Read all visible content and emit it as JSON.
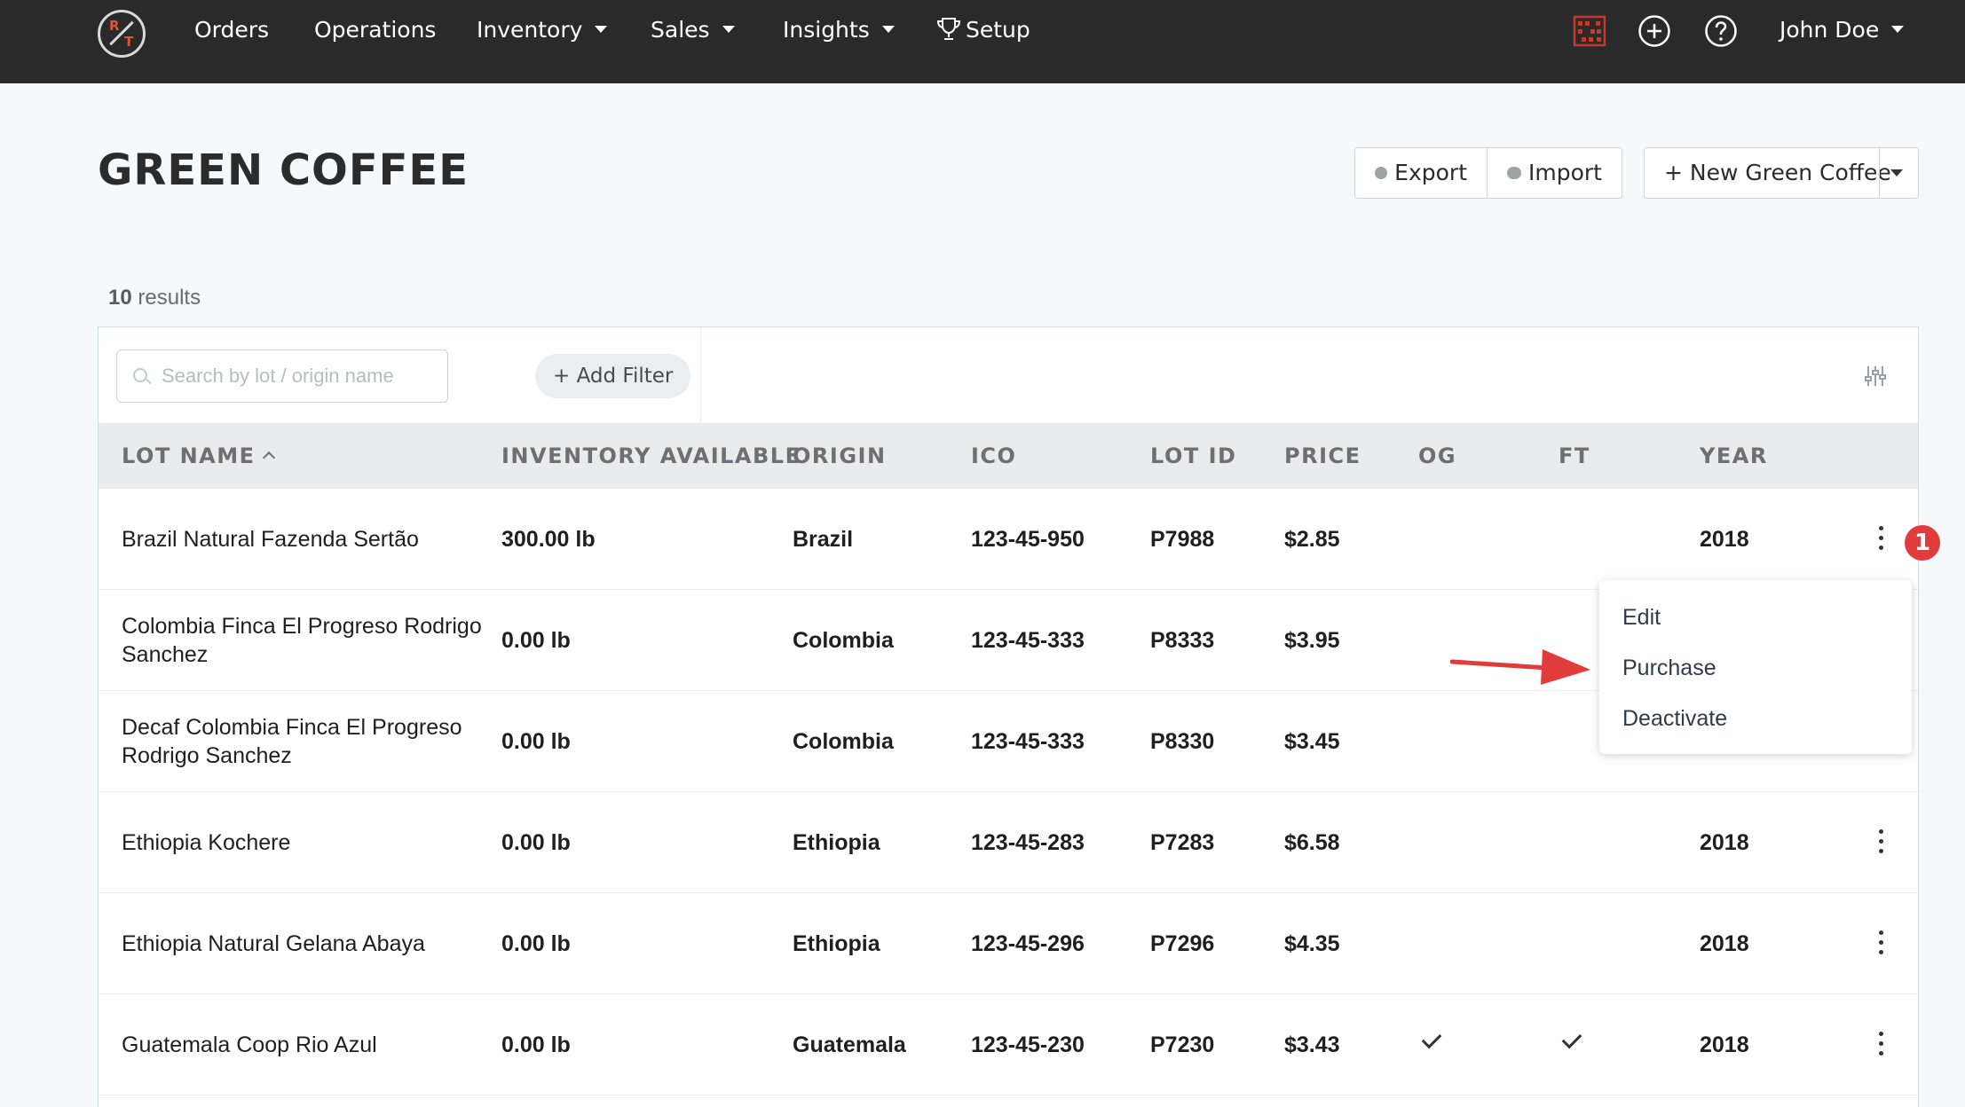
{
  "nav": {
    "logo_letters": [
      "R",
      "T"
    ],
    "items": [
      {
        "label": "Orders"
      },
      {
        "label": "Operations"
      },
      {
        "label": "Inventory"
      },
      {
        "label": "Sales"
      },
      {
        "label": "Insights"
      },
      {
        "label": "Setup"
      }
    ],
    "user": "John Doe",
    "icons": [
      "abacus-icon",
      "plus-circle-icon",
      "help-circle-icon",
      "trophy-icon"
    ]
  },
  "page": {
    "title": "GREEN COFFEE",
    "export_label": "Export",
    "import_label": "Import",
    "new_label": "+ New Green Coffee",
    "results_count": "10",
    "results_label": "results"
  },
  "toolbar": {
    "search_placeholder": "Search by lot / origin name",
    "add_filter_label": "+ Add Filter"
  },
  "table": {
    "columns": [
      "LOT NAME",
      "INVENTORY AVAILABLE",
      "ORIGIN",
      "ICO",
      "LOT ID",
      "PRICE",
      "OG",
      "FT",
      "YEAR"
    ],
    "rows": [
      {
        "name": "Brazil Natural Fazenda Sertão",
        "inventory": "300.00 lb",
        "origin": "Brazil",
        "ico": "123-45-950",
        "lot_id": "P7988",
        "price": "$2.85",
        "og": false,
        "ft": false,
        "year": "2018"
      },
      {
        "name": "Colombia Finca El Progreso Rodrigo Sanchez",
        "inventory": "0.00 lb",
        "origin": "Colombia",
        "ico": "123-45-333",
        "lot_id": "P8333",
        "price": "$3.95",
        "og": false,
        "ft": false,
        "year": ""
      },
      {
        "name": "Decaf Colombia Finca El Progreso Rodrigo Sanchez",
        "inventory": "0.00 lb",
        "origin": "Colombia",
        "ico": "123-45-333",
        "lot_id": "P8330",
        "price": "$3.45",
        "og": false,
        "ft": false,
        "year": ""
      },
      {
        "name": "Ethiopia Kochere",
        "inventory": "0.00 lb",
        "origin": "Ethiopia",
        "ico": "123-45-283",
        "lot_id": "P7283",
        "price": "$6.58",
        "og": false,
        "ft": false,
        "year": "2018"
      },
      {
        "name": "Ethiopia Natural Gelana Abaya",
        "inventory": "0.00 lb",
        "origin": "Ethiopia",
        "ico": "123-45-296",
        "lot_id": "P7296",
        "price": "$4.35",
        "og": false,
        "ft": false,
        "year": "2018"
      },
      {
        "name": "Guatemala Coop Rio Azul",
        "inventory": "0.00 lb",
        "origin": "Guatemala",
        "ico": "123-45-230",
        "lot_id": "P7230",
        "price": "$3.43",
        "og": true,
        "ft": true,
        "year": "2018"
      }
    ]
  },
  "row_menu": {
    "items": [
      "Edit",
      "Purchase",
      "Deactivate"
    ]
  },
  "annotation": {
    "badge_number": "1",
    "colors": {
      "badge": "#e03c3c",
      "arrow": "#e03c3c"
    }
  }
}
